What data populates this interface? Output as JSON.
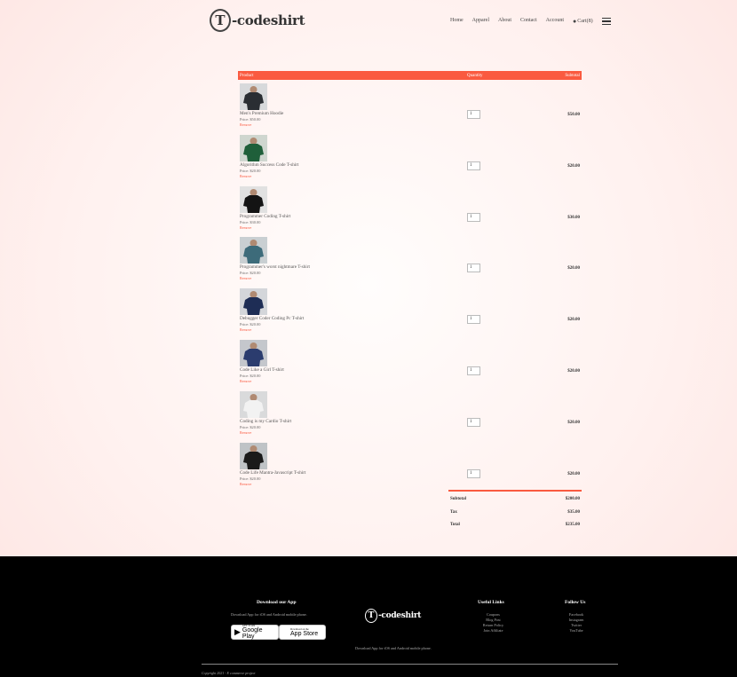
{
  "header": {
    "logo_letter": "T",
    "logo_text": "-codeshirt",
    "nav": [
      "Home",
      "Apparel",
      "About",
      "Contact",
      "Account"
    ],
    "cart_label": "Cart(8)"
  },
  "cart": {
    "columns": {
      "product": "Product",
      "quantity": "Quantity",
      "subtotal": "Subtotal"
    },
    "remove_label": "Remove",
    "items": [
      {
        "name": "Men's Premium Hoodie",
        "price": "Price: $50.00",
        "quantity": "1",
        "subtotal": "$50.00",
        "shirt_color": "#2a2e33",
        "bg": "#d7d9db"
      },
      {
        "name": "Algorithm Success Code T-shirt",
        "price": "Price: $20.00",
        "quantity": "1",
        "subtotal": "$20.00",
        "shirt_color": "#1f5f3a",
        "bg": "#cfd6cf"
      },
      {
        "name": "Programmer Coding T-shirt",
        "price": "Price: $30.00",
        "quantity": "1",
        "subtotal": "$30.00",
        "shirt_color": "#141414",
        "bg": "#e1e1e1"
      },
      {
        "name": "Programmer's worst nightmare T-shirt",
        "price": "Price: $20.00",
        "quantity": "1",
        "subtotal": "$20.00",
        "shirt_color": "#3d6b7a",
        "bg": "#c9cfd2"
      },
      {
        "name": "Debugger Coder Coding Pc T-shirt",
        "price": "Price: $20.00",
        "quantity": "1",
        "subtotal": "$20.00",
        "shirt_color": "#1e2d55",
        "bg": "#d4d6da"
      },
      {
        "name": "Code Like a Girl T-shirt",
        "price": "Price: $20.00",
        "quantity": "1",
        "subtotal": "$20.00",
        "shirt_color": "#2b3c6e",
        "bg": "#c4c7cc"
      },
      {
        "name": "Coding is my Cardio T-shirt",
        "price": "Price: $20.00",
        "quantity": "1",
        "subtotal": "$20.00",
        "shirt_color": "#f2f2f2",
        "bg": "#d9dadb"
      },
      {
        "name": "Code Life Mantra-Javascript T-shirt",
        "price": "Price: $20.00",
        "quantity": "1",
        "subtotal": "$20.00",
        "shirt_color": "#1a1a1a",
        "bg": "#bfc3c6"
      }
    ]
  },
  "totals": [
    {
      "label": "Subtotal",
      "value": "$200.00"
    },
    {
      "label": "Tax",
      "value": "$35.00"
    },
    {
      "label": "Total",
      "value": "$235.00"
    }
  ],
  "footer": {
    "download_title": "Download our App",
    "download_text": "Download App for iOS and Android mobile phone.",
    "google_small": "GET IT ON",
    "google_big": "Google Play",
    "apple_small": "Download on the",
    "apple_big": "App Store",
    "center_text": "Download App for iOS and Android mobile phone.",
    "useful_title": "Useful Links",
    "useful_links": [
      "Coupons",
      "Blog Post",
      "Return Policy",
      "Join Affiliate"
    ],
    "follow_title": "Follow Us",
    "follow_links": [
      "Facebook",
      "Instagram",
      "Twitter",
      "YouTube"
    ],
    "copyright": "Copyright 2021 - E commerce project"
  },
  "colors": {
    "accent": "#fa5a40",
    "footer_bg": "#000000"
  }
}
